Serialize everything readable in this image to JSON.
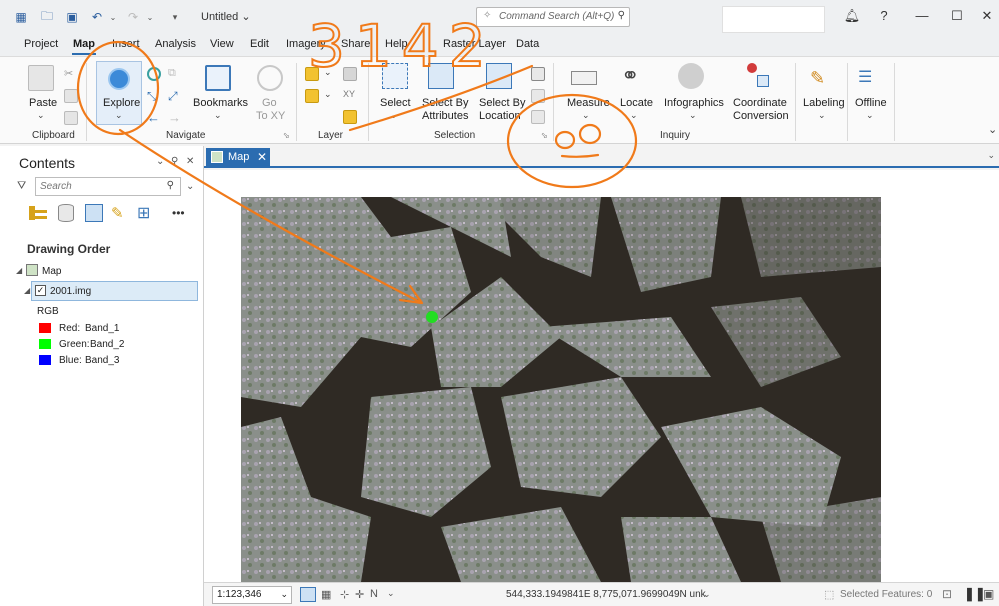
{
  "window": {
    "title": "Untitled",
    "command_search_placeholder": "Command Search (Alt+Q)"
  },
  "menu": [
    "Project",
    "Map",
    "Insert",
    "Analysis",
    "View",
    "Edit",
    "Imagery",
    "Share",
    "Help",
    "Raster Layer",
    "Data"
  ],
  "menu_active": "Map",
  "ribbon": {
    "paste": "Paste",
    "explore": "Explore",
    "bookmarks": "Bookmarks",
    "goto_line1": "Go",
    "goto_line2": "To XY",
    "select": "Select",
    "select_by_attr_line1": "Select By",
    "select_by_attr_line2": "Attributes",
    "select_by_loc_line1": "Select By",
    "select_by_loc_line2": "Location",
    "measure": "Measure",
    "locate": "Locate",
    "infographics": "Infographics",
    "coord_conv_line1": "Coordinate",
    "coord_conv_line2": "Conversion",
    "labeling": "Labeling",
    "offline": "Offline",
    "groups": {
      "clipboard": "Clipboard",
      "navigate": "Navigate",
      "layer": "Layer",
      "selection": "Selection",
      "inquiry": "Inquiry"
    }
  },
  "contents": {
    "title": "Contents",
    "search_placeholder": "Search",
    "drawing_order": "Drawing Order",
    "map_node": "Map",
    "layer_name": "2001.img",
    "rgb_label": "RGB",
    "bands": [
      {
        "label": "Red:",
        "value": "Band_1",
        "color": "#ff0000"
      },
      {
        "label": "Green:",
        "value": "Band_2",
        "color": "#00ff00"
      },
      {
        "label": "Blue:",
        "value": "Band_3",
        "color": "#0000ff"
      }
    ]
  },
  "map_tab": {
    "label": "Map"
  },
  "status": {
    "scale": "1:123,346",
    "coordinates": "544,333.1949841E 8,775,071.9699049N unk",
    "selected_features": "Selected Features: 0"
  },
  "annotation": {
    "handwritten_number": "3142",
    "color": "#f07a1a"
  }
}
